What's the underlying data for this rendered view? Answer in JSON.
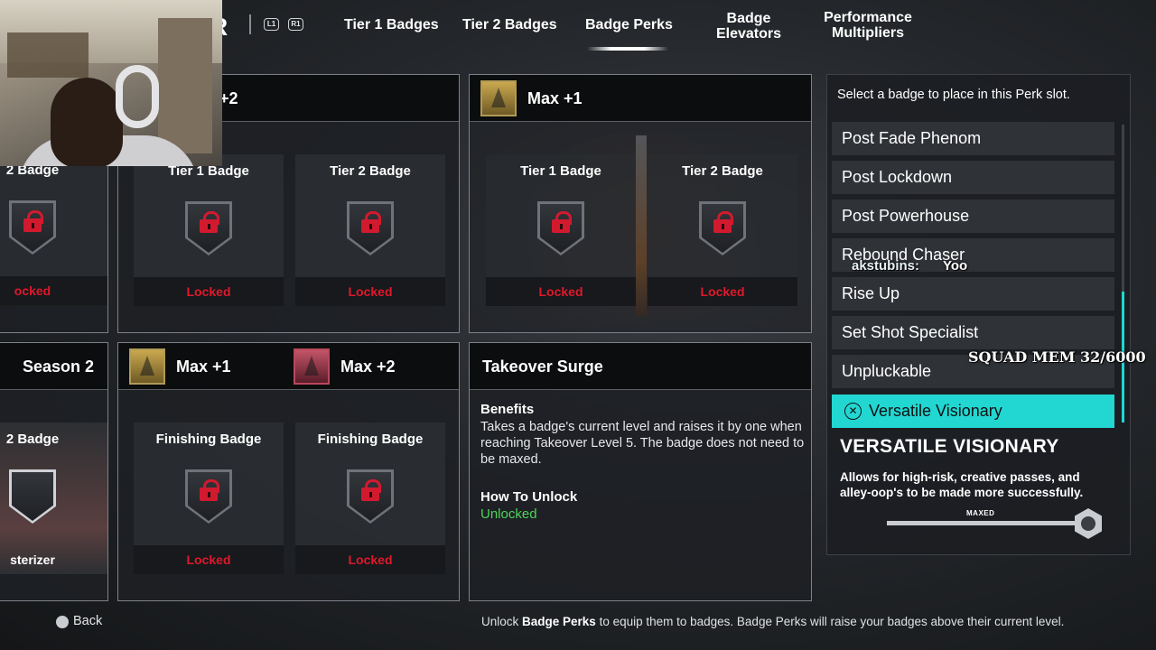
{
  "nav": {
    "logo": "R",
    "left_bumper": "L1",
    "right_bumper": "R1",
    "tabs": [
      {
        "label": "Tier 1 Badges"
      },
      {
        "label": "Tier 2 Badges"
      },
      {
        "label": "Badge Perks"
      },
      {
        "label": "Badge Elevators"
      },
      {
        "label": "Performance Multipliers"
      }
    ],
    "active_tab": "Badge Perks"
  },
  "panels": {
    "top_left": {
      "slot_title": "2 Badge",
      "status": "ocked"
    },
    "top_middle": {
      "header": "+2",
      "slots": [
        {
          "title": "Tier 1 Badge",
          "status": "Locked"
        },
        {
          "title": "Tier 2 Badge",
          "status": "Locked"
        }
      ]
    },
    "top_right": {
      "header": "Max +1",
      "slots": [
        {
          "title": "Tier 1 Badge",
          "status": "Locked"
        },
        {
          "title": "Tier 2 Badge",
          "status": "Locked"
        }
      ]
    },
    "bottom_left": {
      "header": "Season 2",
      "slot_title": "2 Badge",
      "badge_name": "sterizer"
    },
    "bottom_middle": {
      "header_1": "Max +1",
      "header_2": "Max +2",
      "slots": [
        {
          "title": "Finishing Badge",
          "status": "Locked"
        },
        {
          "title": "Finishing Badge",
          "status": "Locked"
        }
      ]
    },
    "takeover": {
      "header": "Takeover Surge",
      "benefits_label": "Benefits",
      "benefits_text": "Takes a badge's current level and raises it by one when reaching Takeover Level 5. The badge does not need to be maxed.",
      "unlock_label": "How To Unlock",
      "unlock_value": "Unlocked"
    }
  },
  "badge_list": {
    "prompt": "Select a badge to place in this Perk slot.",
    "items": [
      {
        "label": "Post Fade Phenom"
      },
      {
        "label": "Post Lockdown"
      },
      {
        "label": "Post Powerhouse"
      },
      {
        "label": "Rebound Chaser"
      },
      {
        "label": "Rise Up"
      },
      {
        "label": "Set Shot Specialist"
      },
      {
        "label": "Unpluckable"
      },
      {
        "label": "Versatile Visionary"
      }
    ],
    "selected": "Versatile Visionary",
    "select_glyph": "✕",
    "detail": {
      "title": "VERSATILE VISIONARY",
      "description": "Allows for high-risk, creative passes, and alley-oop's to be made more successfully.",
      "level_label": "MAXED",
      "level_fraction": 1.0
    }
  },
  "overlays": {
    "chat_user": "akstubins:",
    "chat_message": "Yoo",
    "squad_text": "SQUAD MEM 32/6000"
  },
  "footer": {
    "back_label": "Back",
    "hint_prefix": "Unlock ",
    "hint_bold": "Badge Perks",
    "hint_suffix": " to equip them to badges. Badge Perks will raise your badges above their current level."
  },
  "colors": {
    "accent": "#22d7d1",
    "locked": "#e0182b",
    "unlocked": "#4fd35a"
  }
}
